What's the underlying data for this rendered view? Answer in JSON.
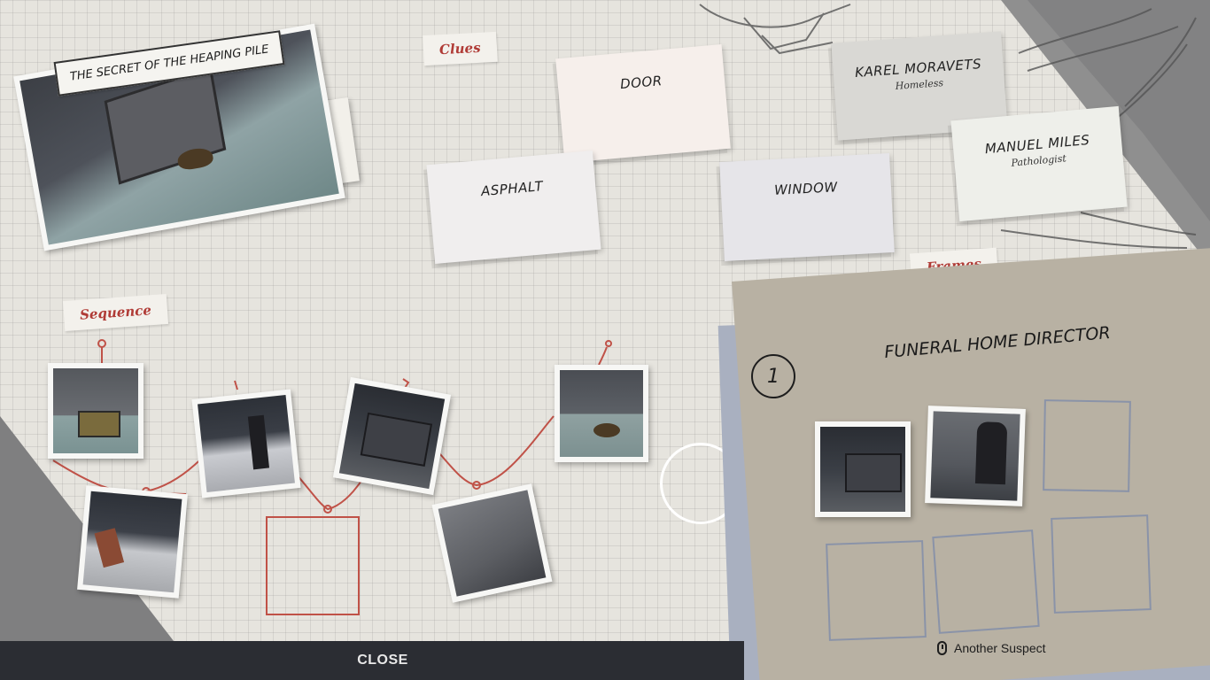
{
  "case": {
    "title": "THE SECRET OF THE HEAPING PILE"
  },
  "labels": {
    "clues": "Clues",
    "sequence": "Sequence",
    "frames": "Frames"
  },
  "clues": [
    {
      "title": "DOOR",
      "subtitle": ""
    },
    {
      "title": "ASPHALT",
      "subtitle": ""
    },
    {
      "title": "WINDOW",
      "subtitle": ""
    },
    {
      "title": "KAREL MORAVETS",
      "subtitle": "Homeless"
    },
    {
      "title": "MANUEL MILES",
      "subtitle": "Pathologist"
    }
  ],
  "frames_panel": {
    "number": "1",
    "title": "FUNERAL HOME DIRECTOR",
    "filled_slots": 2,
    "total_slots": 6
  },
  "footer": {
    "close_label": "CLOSE",
    "another_suspect_label": "Another Suspect",
    "mouse_icon": "mouse-icon"
  },
  "colors": {
    "accent_red": "#b03b36",
    "thread_red": "#c05248",
    "panel_bg": "#b8b1a3",
    "bar_bg": "#2b2d33"
  }
}
